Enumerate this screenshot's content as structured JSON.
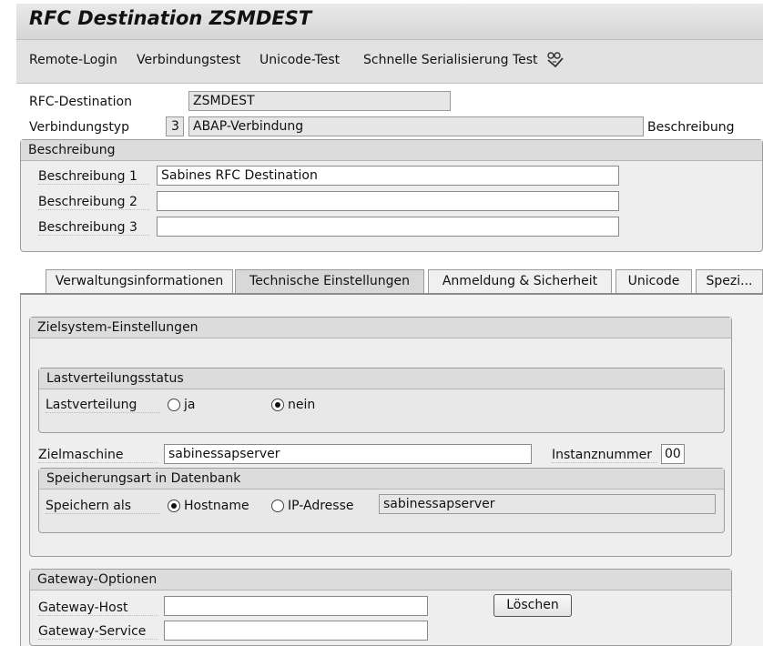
{
  "window": {
    "title": "RFC Destination ZSMDEST"
  },
  "toolbar": {
    "remote_login": "Remote-Login",
    "connection_test": "Verbindungstest",
    "unicode_test": "Unicode-Test",
    "fast_serialization_test": "Schnelle Serialisierung Test"
  },
  "header": {
    "rfc_dest_label": "RFC-Destination",
    "rfc_dest_value": "ZSMDEST",
    "conn_type_label": "Verbindungstyp",
    "conn_type_code": "3",
    "conn_type_value": "ABAP-Verbindung",
    "description_link": "Beschreibung"
  },
  "description_group": {
    "title": "Beschreibung",
    "rows": [
      {
        "label": "Beschreibung 1",
        "value": "Sabines RFC Destination"
      },
      {
        "label": "Beschreibung 2",
        "value": ""
      },
      {
        "label": "Beschreibung 3",
        "value": ""
      }
    ]
  },
  "tabs": [
    {
      "label": "Verwaltungsinformationen"
    },
    {
      "label": "Technische Einstellungen"
    },
    {
      "label": "Anmeldung & Sicherheit"
    },
    {
      "label": "Unicode"
    },
    {
      "label": "Spezi..."
    }
  ],
  "target_system": {
    "title": "Zielsystem-Einstellungen",
    "load_balancing": {
      "title": "Lastverteilungsstatus",
      "label": "Lastverteilung",
      "opt_yes": "ja",
      "opt_no": "nein",
      "selected": "nein"
    },
    "target_host_label": "Zielmaschine",
    "target_host_value": "sabinessapserver",
    "instance_label": "Instanznummer",
    "instance_value": "00",
    "storage": {
      "title": "Speicherungsart in Datenbank",
      "label": "Speichern als",
      "opt_hostname": "Hostname",
      "opt_ip": "IP-Adresse",
      "selected": "Hostname",
      "value": "sabinessapserver"
    }
  },
  "gateway": {
    "title": "Gateway-Optionen",
    "host_label": "Gateway-Host",
    "host_value": "",
    "service_label": "Gateway-Service",
    "service_value": "",
    "delete_button": "Löschen"
  }
}
